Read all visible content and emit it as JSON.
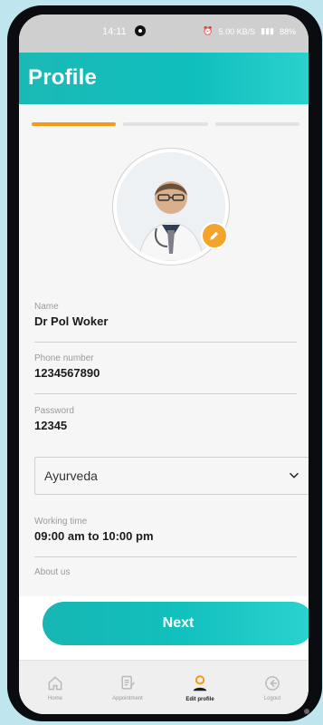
{
  "status_bar": {
    "time": "14:11",
    "right_text": "5.00 KB/S",
    "battery": "88%"
  },
  "header": {
    "title": "Profile"
  },
  "form": {
    "name_label": "Name",
    "name_value": "Dr Pol Woker",
    "phone_label": "Phone number",
    "phone_value": "1234567890",
    "password_label": "Password",
    "password_value": "12345",
    "specialty_value": "Ayurveda",
    "working_time_label": "Working time",
    "working_time_value": "09:00 am to 10:00 pm",
    "about_label": "About us"
  },
  "actions": {
    "next_label": "Next"
  },
  "bottom_nav": {
    "items": [
      {
        "label": "Home"
      },
      {
        "label": "Appointment"
      },
      {
        "label": "Edit profile"
      },
      {
        "label": "Logout"
      }
    ]
  },
  "colors": {
    "primary": "#1bb9b6",
    "accent": "#f4a32b"
  }
}
